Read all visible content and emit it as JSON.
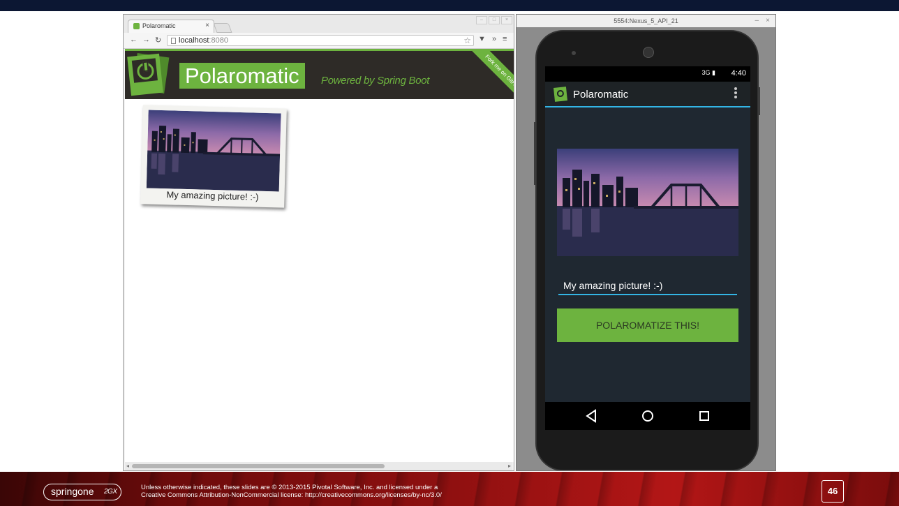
{
  "browser": {
    "tab_title": "Polaromatic",
    "tab_close": "×",
    "url_host": "localhost",
    "url_port": ":8080",
    "page": {
      "brand": "Polaromatic",
      "tagline": "Powered by Spring Boot",
      "ribbon": "Fork me on GitHub",
      "polaroid_caption": "My amazing picture! :-)"
    }
  },
  "emulator": {
    "window_title": "5554:Nexus_5_API_21",
    "status_signal": "3G",
    "status_time": "4:40",
    "app_title": "Polaromatic",
    "caption_value": "My amazing picture! :-)",
    "button_label": "POLAROMATIZE THIS!"
  },
  "footer": {
    "logo_text": "springone",
    "logo_suffix": "2GX",
    "license_line1": "Unless otherwise indicated, these slides are © 2013-2015 Pivotal Software, Inc. and licensed under a",
    "license_line2": "Creative Commons Attribution-NonCommercial license: http://creativecommons.org/licenses/by-nc/3.0/",
    "page_number": "46"
  },
  "colors": {
    "spring_green": "#6db33f",
    "banner_dark": "#2e2b27",
    "holo_blue": "#33b5e5"
  }
}
